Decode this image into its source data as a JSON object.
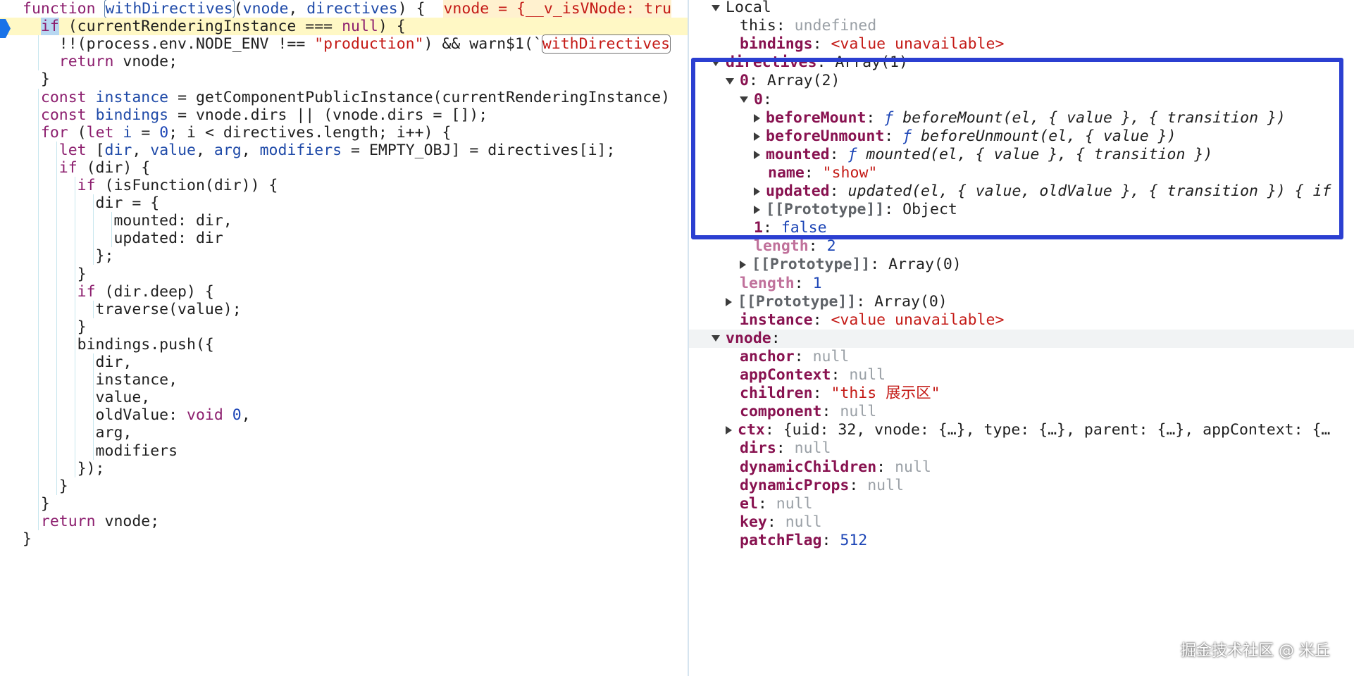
{
  "code": {
    "lines": [
      [
        {
          "t": "function ",
          "c": "k"
        },
        {
          "t": "withDirectives",
          "c": "fn boxed"
        },
        {
          "t": "("
        },
        {
          "t": "vnode",
          "c": "fn"
        },
        {
          "t": ", "
        },
        {
          "t": "directives",
          "c": "fn"
        },
        {
          "t": ") {  "
        },
        {
          "t": "vnode = {__v_isVNode: tru",
          "c": "inline-val"
        }
      ],
      [
        {
          "t": "  "
        },
        {
          "t": "if",
          "c": "k hl-if"
        },
        {
          "t": " (currentRenderingInstance === "
        },
        {
          "t": "null",
          "c": "k"
        },
        {
          "t": ") {"
        }
      ],
      [
        {
          "t": "    !!(process.env.NODE_ENV !== "
        },
        {
          "t": "\"production\"",
          "c": "str"
        },
        {
          "t": ") && warn$1(`"
        },
        {
          "t": "withDirectives",
          "c": "strbox"
        }
      ],
      [
        {
          "t": "    "
        },
        {
          "t": "return",
          "c": "k"
        },
        {
          "t": " vnode;"
        }
      ],
      [
        {
          "t": "  }"
        }
      ],
      [
        {
          "t": "  "
        },
        {
          "t": "const",
          "c": "k"
        },
        {
          "t": " "
        },
        {
          "t": "instance",
          "c": "fn"
        },
        {
          "t": " = getComponentPublicInstance(currentRenderingInstance)"
        }
      ],
      [
        {
          "t": "  "
        },
        {
          "t": "const",
          "c": "k"
        },
        {
          "t": " "
        },
        {
          "t": "bindings",
          "c": "fn"
        },
        {
          "t": " = vnode.dirs || (vnode.dirs = []);"
        }
      ],
      [
        {
          "t": "  "
        },
        {
          "t": "for",
          "c": "k"
        },
        {
          "t": " ("
        },
        {
          "t": "let",
          "c": "k"
        },
        {
          "t": " "
        },
        {
          "t": "i",
          "c": "fn"
        },
        {
          "t": " = "
        },
        {
          "t": "0",
          "c": "num"
        },
        {
          "t": "; i < directives.length; i++) {"
        }
      ],
      [
        {
          "t": "    "
        },
        {
          "t": "let",
          "c": "k"
        },
        {
          "t": " ["
        },
        {
          "t": "dir",
          "c": "fn"
        },
        {
          "t": ", "
        },
        {
          "t": "value",
          "c": "fn"
        },
        {
          "t": ", "
        },
        {
          "t": "arg",
          "c": "fn"
        },
        {
          "t": ", "
        },
        {
          "t": "modifiers",
          "c": "fn"
        },
        {
          "t": " = EMPTY_OBJ] = directives[i];"
        }
      ],
      [
        {
          "t": "    "
        },
        {
          "t": "if",
          "c": "k"
        },
        {
          "t": " (dir) {"
        }
      ],
      [
        {
          "t": "      "
        },
        {
          "t": "if",
          "c": "k"
        },
        {
          "t": " (isFunction(dir)) {"
        }
      ],
      [
        {
          "t": "        dir = {"
        }
      ],
      [
        {
          "t": "          mounted: dir,"
        }
      ],
      [
        {
          "t": "          updated: dir"
        }
      ],
      [
        {
          "t": "        };"
        }
      ],
      [
        {
          "t": "      }"
        }
      ],
      [
        {
          "t": "      "
        },
        {
          "t": "if",
          "c": "k"
        },
        {
          "t": " (dir.deep) {"
        }
      ],
      [
        {
          "t": "        traverse(value);"
        }
      ],
      [
        {
          "t": "      }"
        }
      ],
      [
        {
          "t": "      bindings.push({"
        }
      ],
      [
        {
          "t": "        dir,"
        }
      ],
      [
        {
          "t": "        instance,"
        }
      ],
      [
        {
          "t": "        value,"
        }
      ],
      [
        {
          "t": "        oldValue: "
        },
        {
          "t": "void",
          "c": "k"
        },
        {
          "t": " "
        },
        {
          "t": "0",
          "c": "num"
        },
        {
          "t": ","
        }
      ],
      [
        {
          "t": "        arg,"
        }
      ],
      [
        {
          "t": "        modifiers"
        }
      ],
      [
        {
          "t": "      });"
        }
      ],
      [
        {
          "t": "    }"
        }
      ],
      [
        {
          "t": "  }"
        }
      ],
      [
        {
          "t": "  "
        },
        {
          "t": "return",
          "c": "k"
        },
        {
          "t": " vnode;"
        }
      ],
      [
        {
          "t": "}"
        }
      ]
    ]
  },
  "scope": {
    "rows": [
      {
        "tri": "down",
        "key": "Local",
        "kc": "light",
        "val": ""
      },
      {
        "tri": "",
        "key": "this",
        "kc": "light",
        "val": "undefined",
        "vc": "val-null"
      },
      {
        "tri": "",
        "key": "bindings",
        "val": "<value unavailable>",
        "vc": "val-str"
      },
      {
        "tri": "down",
        "key": "directives",
        "val": "Array(1)",
        "vc": "val-obj"
      },
      {
        "tri": "down",
        "key": "0",
        "val": "Array(2)",
        "vc": "val-obj"
      },
      {
        "tri": "down",
        "key": "0",
        "val": "",
        "vc": "val-obj"
      },
      {
        "tri": "right",
        "key": "beforeMount",
        "f": "ƒ",
        "val": "beforeMount(el, { value }, { transition })",
        "vc": "val-fn"
      },
      {
        "tri": "right",
        "key": "beforeUnmount",
        "f": "ƒ",
        "val": "beforeUnmount(el, { value })",
        "vc": "val-fn"
      },
      {
        "tri": "right",
        "key": "mounted",
        "f": "ƒ",
        "val": "mounted(el, { value }, { transition })",
        "vc": "val-fn"
      },
      {
        "tri": "",
        "key": "name",
        "val": "\"show\"",
        "vc": "val-str"
      },
      {
        "tri": "right",
        "key": "updated",
        "val": "updated(el, { value, oldValue }, { transition }) { if",
        "vc": "val-fn"
      },
      {
        "tri": "right",
        "key": "[[Prototype]]",
        "kc": "proto",
        "val": "Object",
        "vc": "val-obj"
      },
      {
        "tri": "",
        "key": "1",
        "val": "false",
        "vc": "val-num"
      },
      {
        "tri": "",
        "key": "length",
        "kc": "dim",
        "val": "2",
        "vc": "val-num"
      },
      {
        "tri": "right",
        "key": "[[Prototype]]",
        "kc": "proto",
        "val": "Array(0)",
        "vc": "val-obj"
      },
      {
        "tri": "",
        "key": "length",
        "kc": "dim",
        "val": "1",
        "vc": "val-num"
      },
      {
        "tri": "right",
        "key": "[[Prototype]]",
        "kc": "proto",
        "val": "Array(0)",
        "vc": "val-obj"
      },
      {
        "tri": "",
        "key": "instance",
        "val": "<value unavailable>",
        "vc": "val-str"
      },
      {
        "tri": "down",
        "key": "vnode",
        "val": "",
        "vc": "val-obj",
        "section": true
      },
      {
        "tri": "",
        "key": "anchor",
        "val": "null",
        "vc": "val-null"
      },
      {
        "tri": "",
        "key": "appContext",
        "val": "null",
        "vc": "val-null"
      },
      {
        "tri": "",
        "key": "children",
        "val": "\"this 展示区\"",
        "vc": "val-str"
      },
      {
        "tri": "",
        "key": "component",
        "val": "null",
        "vc": "val-null"
      },
      {
        "tri": "right",
        "key": "ctx",
        "val": "{uid: 32, vnode: {…}, type: {…}, parent: {…}, appContext: {…",
        "vc": "val-obj"
      },
      {
        "tri": "",
        "key": "dirs",
        "val": "null",
        "vc": "val-null"
      },
      {
        "tri": "",
        "key": "dynamicChildren",
        "val": "null",
        "vc": "val-null"
      },
      {
        "tri": "",
        "key": "dynamicProps",
        "val": "null",
        "vc": "val-null"
      },
      {
        "tri": "",
        "key": "el",
        "val": "null",
        "vc": "val-null"
      },
      {
        "tri": "",
        "key": "key",
        "val": "null",
        "vc": "val-null"
      },
      {
        "tri": "",
        "key": "patchFlag",
        "val": "512",
        "vc": "val-num"
      }
    ]
  },
  "watermark": "掘金技术社区 @ 米丘",
  "colors": {
    "highlight_box": "#2b3fd1",
    "exec_line": "#fff8c5"
  }
}
